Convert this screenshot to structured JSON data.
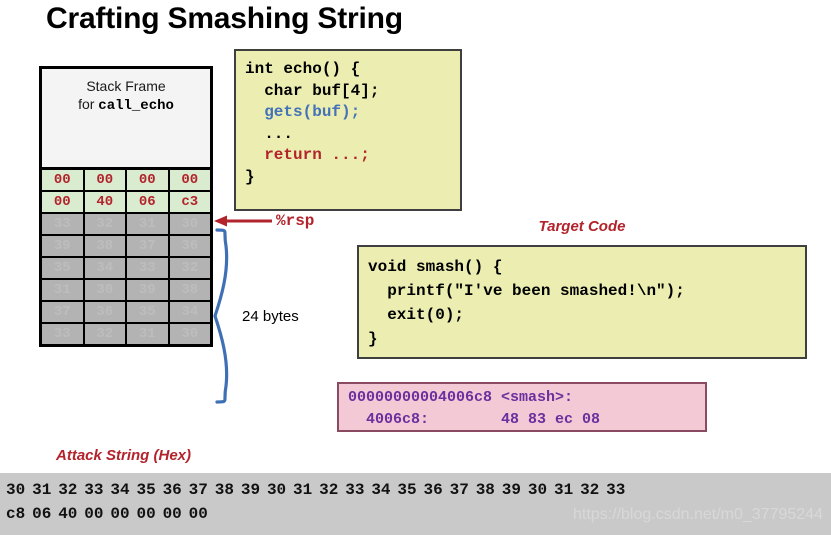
{
  "title": "Crafting Smashing String",
  "stack": {
    "header_line1": "Stack Frame",
    "header_line2_prefix": "for ",
    "header_line2_fn": "call_echo",
    "rsp_label": "%rsp",
    "size_label": "24 bytes",
    "green_rows": [
      [
        "00",
        "00",
        "00",
        "00"
      ],
      [
        "00",
        "40",
        "06",
        "c3"
      ]
    ],
    "gray_rows": [
      [
        "33",
        "32",
        "31",
        "30"
      ],
      [
        "39",
        "38",
        "37",
        "36"
      ],
      [
        "35",
        "34",
        "33",
        "32"
      ],
      [
        "31",
        "30",
        "39",
        "38"
      ],
      [
        "37",
        "36",
        "35",
        "34"
      ],
      [
        "33",
        "32",
        "31",
        "30"
      ]
    ]
  },
  "echo_code": {
    "line1": "int echo() {",
    "line2": "  char buf[4];",
    "line3": "  gets(buf);",
    "line4": "  ...",
    "line5": "  return ...;",
    "line6": "}"
  },
  "target_code": {
    "title": "Target Code",
    "line1": "void smash() {",
    "line2": "  printf(\"I've been smashed!\\n\");",
    "line3": "  exit(0);",
    "line4": "}"
  },
  "disassembly": {
    "line1": "00000000004006c8 <smash>:",
    "line2": "  4006c8:        48 83 ec 08"
  },
  "attack_string": {
    "title": "Attack String (Hex)",
    "row1": [
      "30",
      "31",
      "32",
      "33",
      "34",
      "35",
      "36",
      "37",
      "38",
      "39",
      "30",
      "31",
      "32",
      "33",
      "34",
      "35",
      "36",
      "37",
      "38",
      "39",
      "30",
      "31",
      "32",
      "33"
    ],
    "row2": [
      "c8",
      "06",
      "40",
      "00",
      "00",
      "00",
      "00",
      "00"
    ]
  },
  "watermark": "https://blog.csdn.net/m0_37795244",
  "colors": {
    "accent_red": "#b2232b",
    "code_bg": "#ebeeb0",
    "green_cell": "#d9ecd0",
    "gray_cell": "#b3b3b3",
    "disasm_bg": "#f2c9d5",
    "disasm_fg": "#6b2f9e",
    "brace_blue": "#3f6fb5",
    "band_gray": "#c9c9c9"
  }
}
